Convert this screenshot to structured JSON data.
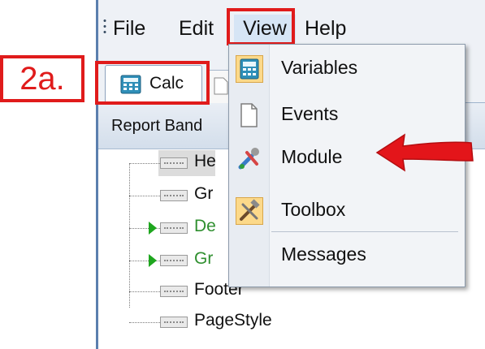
{
  "menubar": {
    "items": [
      {
        "label": "File"
      },
      {
        "label": "Edit"
      },
      {
        "label": "View"
      },
      {
        "label": "Help"
      }
    ]
  },
  "tabs": {
    "calc_label": "Calc"
  },
  "annotation": {
    "step_label": "2a.",
    "highlight_color": "#e01b1b"
  },
  "panel": {
    "header": "Report Band"
  },
  "tree": {
    "items": [
      {
        "label": "He",
        "icon": "band-icon"
      },
      {
        "label": "Gr",
        "icon": "band-icon"
      },
      {
        "label": "De",
        "icon": "band-icon",
        "expandable": true
      },
      {
        "label": "Gr",
        "icon": "band-icon",
        "expandable": true
      },
      {
        "label": "Footer",
        "icon": "band-icon"
      },
      {
        "label": "PageStyle",
        "icon": "band-icon"
      }
    ]
  },
  "view_menu": {
    "items": [
      {
        "label": "Variables",
        "icon": "calculator-icon",
        "checked": true
      },
      {
        "label": "Events",
        "icon": "document-icon"
      },
      {
        "label": "Module",
        "icon": "tools-icon"
      },
      {
        "label": "Toolbox",
        "icon": "toolbox-icon",
        "checked": true
      },
      {
        "label": "Messages",
        "icon": ""
      }
    ]
  }
}
